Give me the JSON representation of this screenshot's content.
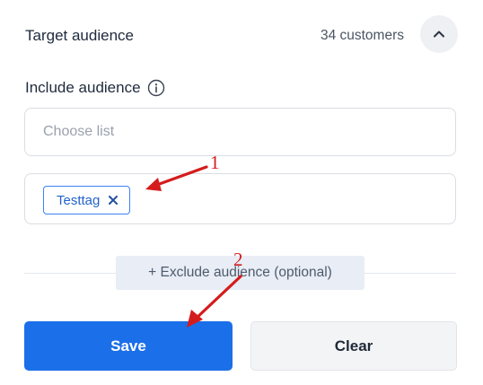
{
  "header": {
    "title": "Target audience",
    "count": "34 customers",
    "collapse_icon": "chevron-up-icon"
  },
  "include": {
    "label": "Include audience",
    "info_icon": "info-icon",
    "choose_placeholder": "Choose list",
    "tags": [
      {
        "label": "Testtag",
        "remove_icon": "close-icon"
      }
    ]
  },
  "exclude": {
    "button_label": "+ Exclude audience (optional)"
  },
  "actions": {
    "save_label": "Save",
    "clear_label": "Clear"
  },
  "annotations": {
    "first": "1",
    "second": "2",
    "color": "#d41c1c"
  },
  "colors": {
    "primary": "#1b6fe8",
    "tag_border": "#3b82f6",
    "tag_text": "#2563c9"
  }
}
